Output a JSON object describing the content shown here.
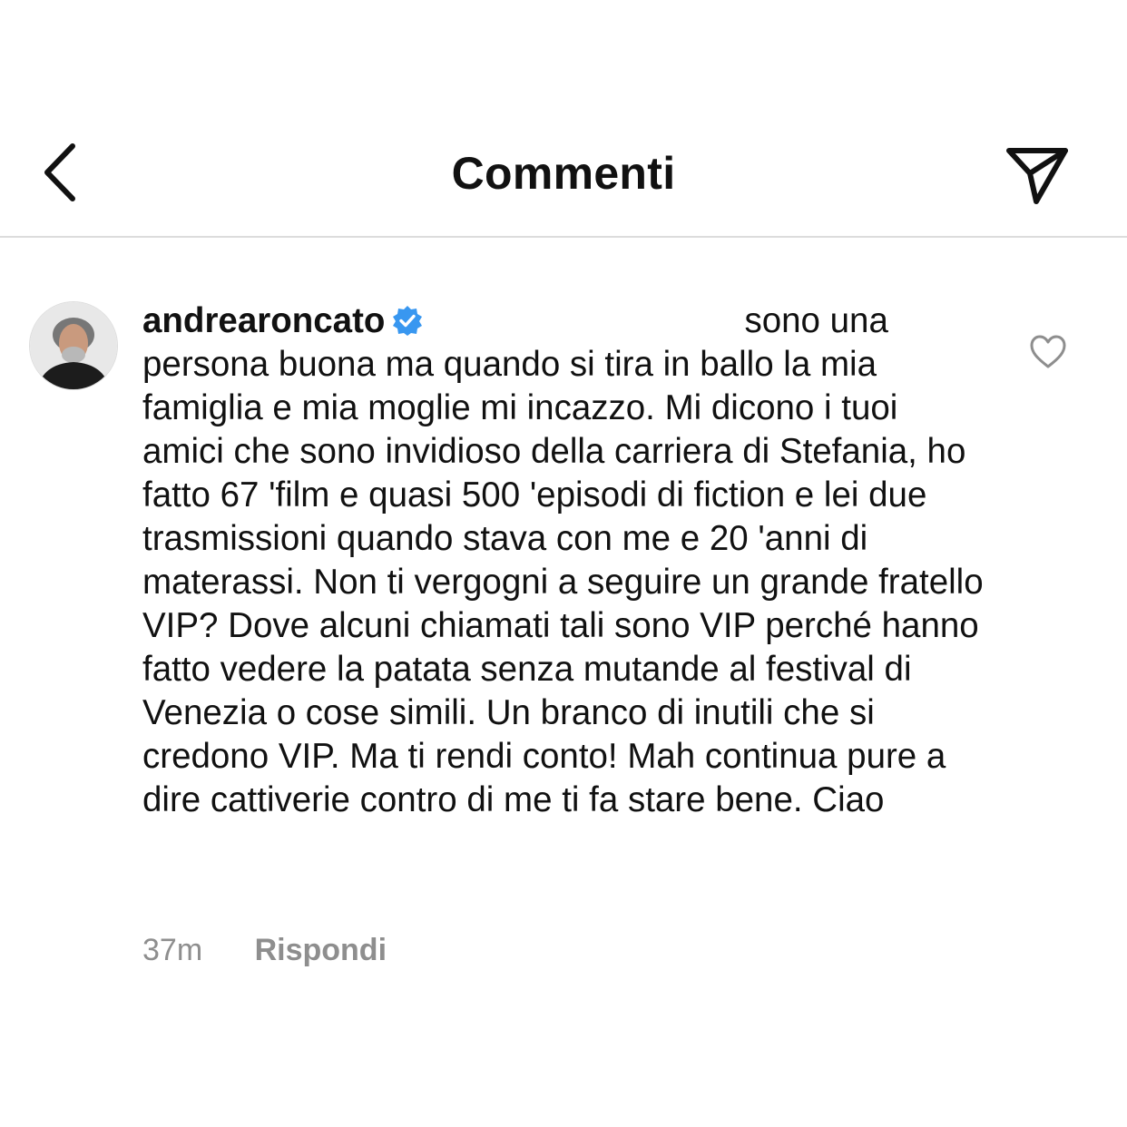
{
  "header": {
    "title": "Commenti",
    "back_icon": "chevron-left-icon",
    "share_icon": "paper-plane-icon"
  },
  "comment": {
    "username": "andrearoncato",
    "verified_icon": "verified-badge-icon",
    "verified_color": "#3897f0",
    "text": "sono una persona buona ma quando si tira in ballo la mia famiglia e mia moglie mi incazzo. Mi dicono i tuoi amici che sono invidioso della carriera di Stefania, ho fatto 67 'film e quasi 500 'episodi di fiction e lei due trasmissioni quando stava con me e 20 'anni di materassi. Non ti vergogni a seguire un grande fratello VIP? Dove alcuni chiamati tali sono VIP perché hanno fatto vedere la patata senza mutande al festival di Venezia o cose simili. Un branco di inutili che si credono VIP. Ma ti rendi conto! Mah continua pure a dire cattiverie contro di me ti fa  stare bene. Ciao",
    "timestamp": "37m",
    "reply_label": "Rispondi",
    "like_icon": "heart-outline-icon"
  }
}
